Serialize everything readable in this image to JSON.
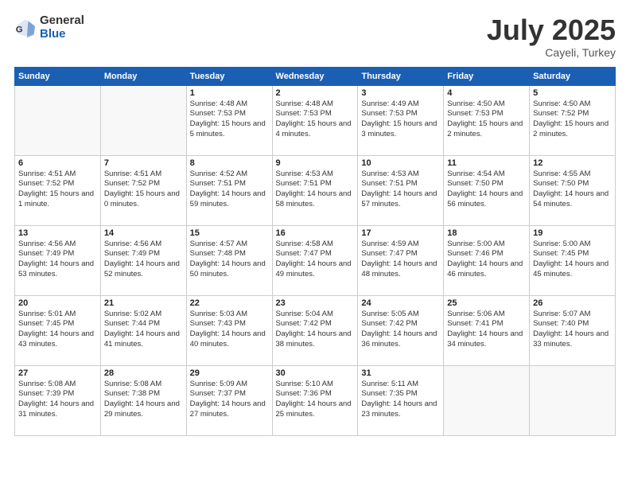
{
  "logo": {
    "general": "General",
    "blue": "Blue"
  },
  "header": {
    "month": "July 2025",
    "location": "Cayeli, Turkey"
  },
  "weekdays": [
    "Sunday",
    "Monday",
    "Tuesday",
    "Wednesday",
    "Thursday",
    "Friday",
    "Saturday"
  ],
  "weeks": [
    [
      {
        "day": null
      },
      {
        "day": null
      },
      {
        "day": "1",
        "sunrise": "4:48 AM",
        "sunset": "7:53 PM",
        "daylight": "15 hours and 5 minutes."
      },
      {
        "day": "2",
        "sunrise": "4:48 AM",
        "sunset": "7:53 PM",
        "daylight": "15 hours and 4 minutes."
      },
      {
        "day": "3",
        "sunrise": "4:49 AM",
        "sunset": "7:53 PM",
        "daylight": "15 hours and 3 minutes."
      },
      {
        "day": "4",
        "sunrise": "4:50 AM",
        "sunset": "7:53 PM",
        "daylight": "15 hours and 2 minutes."
      },
      {
        "day": "5",
        "sunrise": "4:50 AM",
        "sunset": "7:52 PM",
        "daylight": "15 hours and 2 minutes."
      }
    ],
    [
      {
        "day": "6",
        "sunrise": "4:51 AM",
        "sunset": "7:52 PM",
        "daylight": "15 hours and 1 minute."
      },
      {
        "day": "7",
        "sunrise": "4:51 AM",
        "sunset": "7:52 PM",
        "daylight": "15 hours and 0 minutes."
      },
      {
        "day": "8",
        "sunrise": "4:52 AM",
        "sunset": "7:51 PM",
        "daylight": "14 hours and 59 minutes."
      },
      {
        "day": "9",
        "sunrise": "4:53 AM",
        "sunset": "7:51 PM",
        "daylight": "14 hours and 58 minutes."
      },
      {
        "day": "10",
        "sunrise": "4:53 AM",
        "sunset": "7:51 PM",
        "daylight": "14 hours and 57 minutes."
      },
      {
        "day": "11",
        "sunrise": "4:54 AM",
        "sunset": "7:50 PM",
        "daylight": "14 hours and 56 minutes."
      },
      {
        "day": "12",
        "sunrise": "4:55 AM",
        "sunset": "7:50 PM",
        "daylight": "14 hours and 54 minutes."
      }
    ],
    [
      {
        "day": "13",
        "sunrise": "4:56 AM",
        "sunset": "7:49 PM",
        "daylight": "14 hours and 53 minutes."
      },
      {
        "day": "14",
        "sunrise": "4:56 AM",
        "sunset": "7:49 PM",
        "daylight": "14 hours and 52 minutes."
      },
      {
        "day": "15",
        "sunrise": "4:57 AM",
        "sunset": "7:48 PM",
        "daylight": "14 hours and 50 minutes."
      },
      {
        "day": "16",
        "sunrise": "4:58 AM",
        "sunset": "7:47 PM",
        "daylight": "14 hours and 49 minutes."
      },
      {
        "day": "17",
        "sunrise": "4:59 AM",
        "sunset": "7:47 PM",
        "daylight": "14 hours and 48 minutes."
      },
      {
        "day": "18",
        "sunrise": "5:00 AM",
        "sunset": "7:46 PM",
        "daylight": "14 hours and 46 minutes."
      },
      {
        "day": "19",
        "sunrise": "5:00 AM",
        "sunset": "7:45 PM",
        "daylight": "14 hours and 45 minutes."
      }
    ],
    [
      {
        "day": "20",
        "sunrise": "5:01 AM",
        "sunset": "7:45 PM",
        "daylight": "14 hours and 43 minutes."
      },
      {
        "day": "21",
        "sunrise": "5:02 AM",
        "sunset": "7:44 PM",
        "daylight": "14 hours and 41 minutes."
      },
      {
        "day": "22",
        "sunrise": "5:03 AM",
        "sunset": "7:43 PM",
        "daylight": "14 hours and 40 minutes."
      },
      {
        "day": "23",
        "sunrise": "5:04 AM",
        "sunset": "7:42 PM",
        "daylight": "14 hours and 38 minutes."
      },
      {
        "day": "24",
        "sunrise": "5:05 AM",
        "sunset": "7:42 PM",
        "daylight": "14 hours and 36 minutes."
      },
      {
        "day": "25",
        "sunrise": "5:06 AM",
        "sunset": "7:41 PM",
        "daylight": "14 hours and 34 minutes."
      },
      {
        "day": "26",
        "sunrise": "5:07 AM",
        "sunset": "7:40 PM",
        "daylight": "14 hours and 33 minutes."
      }
    ],
    [
      {
        "day": "27",
        "sunrise": "5:08 AM",
        "sunset": "7:39 PM",
        "daylight": "14 hours and 31 minutes."
      },
      {
        "day": "28",
        "sunrise": "5:08 AM",
        "sunset": "7:38 PM",
        "daylight": "14 hours and 29 minutes."
      },
      {
        "day": "29",
        "sunrise": "5:09 AM",
        "sunset": "7:37 PM",
        "daylight": "14 hours and 27 minutes."
      },
      {
        "day": "30",
        "sunrise": "5:10 AM",
        "sunset": "7:36 PM",
        "daylight": "14 hours and 25 minutes."
      },
      {
        "day": "31",
        "sunrise": "5:11 AM",
        "sunset": "7:35 PM",
        "daylight": "14 hours and 23 minutes."
      },
      {
        "day": null
      },
      {
        "day": null
      }
    ]
  ]
}
